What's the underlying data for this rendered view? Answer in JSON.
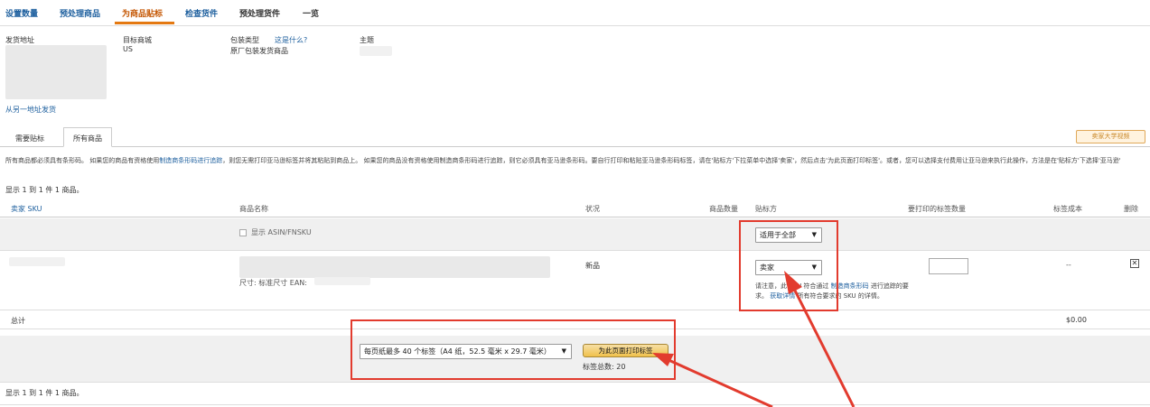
{
  "tabs": [
    "设置数量",
    "预处理商品",
    "为商品贴标",
    "检查货件",
    "预处理货件",
    "一览"
  ],
  "ship_from": {
    "label": "发货地址",
    "change_link": "从另一地址发货"
  },
  "marketplace": {
    "label": "目标商城",
    "value": "US"
  },
  "packing": {
    "label": "包装类型",
    "help_link": "这是什么?",
    "value": "原厂包装发货商品"
  },
  "subject": {
    "label": "主题"
  },
  "subtabs": [
    "需要贴标",
    "所有商品"
  ],
  "video_button": "卖家大学视频",
  "notice": {
    "text1": "所有商品都必须具有条形码。 如果您的商品有资格使用",
    "link1": "制造商条形码进行追踪",
    "text2": "，则您无需打印亚马逊标签并将其粘贴到商品上。 如果您的商品没有资格使用制造商条形码进行追踪，则它必须具有亚马逊条形码。要自行打印和粘贴亚马逊条形码标签，请在'贴标方'下拉菜单中选择'卖家'，然后点击'为此页面打印标签'。或者，您可以选择支付费用让亚马逊来执行此操作，方法是在'贴标方'下选择'亚马逊'"
  },
  "showing_text": "显示 1 到 1 件 1 商品。",
  "table": {
    "headers": {
      "sku": "卖家 SKU",
      "name": "商品名称",
      "condition": "状况",
      "qty": "商品数量",
      "labeler": "贴标方",
      "print_qty": "要打印的标签数量",
      "cost": "标签成本",
      "delete": "删除"
    },
    "show_asin_label": "显示 ASIN/FNSKU",
    "apply_all_value": "适用于全部",
    "row": {
      "condition": "新品",
      "size_text": "尺寸: 标准尺寸 EAN:",
      "labeler_value": "卖家",
      "cost": "--",
      "delete_symbol": "✕"
    },
    "warning": {
      "text1": "请注意，此 SKU 符合通过",
      "link1": "制造商条形码",
      "text2": "进行追踪的要求。",
      "link2": "获取详情",
      "text3": "所有符合要求的 SKU 的详情。"
    },
    "total_label": "总计",
    "total_value": "$0.00"
  },
  "print": {
    "paper_select": "每页纸最多 40 个标签（A4 纸，52.5 毫米 x 29.7 毫米）",
    "button": "为此页面打印标签",
    "total_labels": "标签总数: 20"
  },
  "colors": {
    "accent_orange": "#e47911",
    "link_blue": "#1d5f9e",
    "highlight_red": "#e23b2e"
  }
}
